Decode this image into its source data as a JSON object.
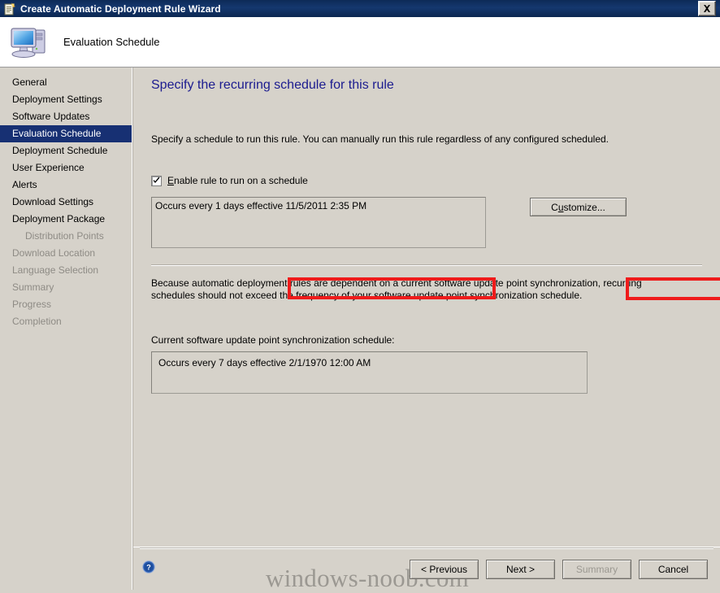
{
  "window": {
    "title": "Create Automatic Deployment Rule Wizard",
    "title_icon": "wizard-document-icon",
    "close_label": "✕"
  },
  "header": {
    "icon": "computer-monitor-icon",
    "title": "Evaluation Schedule"
  },
  "sidebar": {
    "items": [
      {
        "label": "General",
        "state": "normal",
        "indent": false
      },
      {
        "label": "Deployment Settings",
        "state": "normal",
        "indent": false
      },
      {
        "label": "Software Updates",
        "state": "normal",
        "indent": false
      },
      {
        "label": "Evaluation Schedule",
        "state": "selected",
        "indent": false
      },
      {
        "label": "Deployment Schedule",
        "state": "normal",
        "indent": false
      },
      {
        "label": "User Experience",
        "state": "normal",
        "indent": false
      },
      {
        "label": "Alerts",
        "state": "normal",
        "indent": false
      },
      {
        "label": "Download Settings",
        "state": "normal",
        "indent": false
      },
      {
        "label": "Deployment Package",
        "state": "normal",
        "indent": false
      },
      {
        "label": "Distribution Points",
        "state": "disabled",
        "indent": true
      },
      {
        "label": "Download Location",
        "state": "disabled",
        "indent": false
      },
      {
        "label": "Language Selection",
        "state": "disabled",
        "indent": false
      },
      {
        "label": "Summary",
        "state": "disabled",
        "indent": false
      },
      {
        "label": "Progress",
        "state": "disabled",
        "indent": false
      },
      {
        "label": "Completion",
        "state": "disabled",
        "indent": false
      }
    ]
  },
  "main": {
    "page_title": "Specify the recurring schedule for this rule",
    "intro_text": "Specify a schedule to run this rule. You can manually run this rule regardless of any configured scheduled.",
    "enable_checkbox": {
      "accel": "E",
      "label_rest": "nable rule to run on a schedule",
      "checked": true,
      "check_glyph": "✔"
    },
    "schedule_value": "Occurs every 1 days effective 11/5/2011 2:35 PM",
    "customize_button": {
      "before": "C",
      "accel": "u",
      "after": "stomize..."
    },
    "note_text": "Because automatic deployment rules are dependent on a current software update point synchronization, recurring schedules should not exceed the frequency of your software update point synchronization schedule.",
    "sync_label": "Current software update point synchronization schedule:",
    "sync_value": "Occurs every 7 days effective 2/1/1970 12:00 AM"
  },
  "footer": {
    "help_icon": "help-question-icon",
    "watermark": "windows-noob.com",
    "buttons": [
      {
        "label": "< Previous",
        "disabled": false
      },
      {
        "label": "Next >",
        "disabled": false
      },
      {
        "label": "Summary",
        "disabled": true
      },
      {
        "label": "Cancel",
        "disabled": false
      }
    ]
  },
  "colors": {
    "titlebar": "#0d2a57",
    "face": "#d6d2ca",
    "selection": "#173073",
    "page_title": "#1b1b8f",
    "annotation": "#ef1b1b",
    "disabled_text": "#8e8b85"
  }
}
